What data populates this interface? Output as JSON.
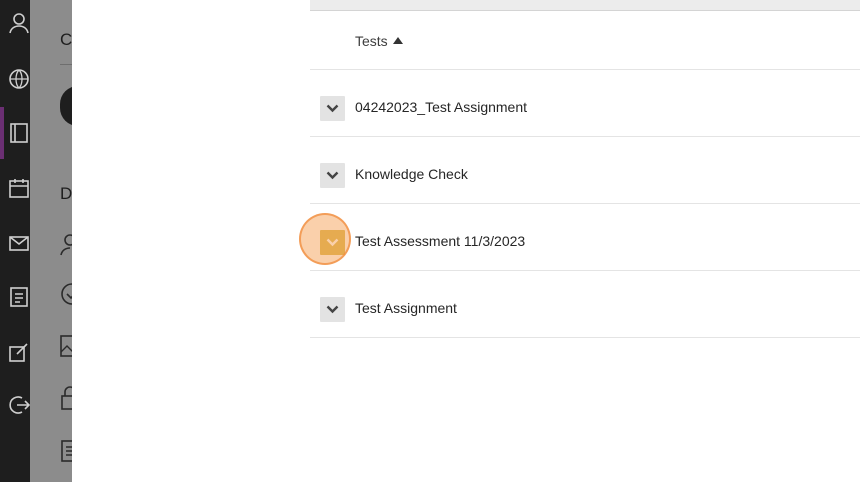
{
  "left_nav": {
    "icons": [
      "user-icon",
      "globe-icon",
      "courses-icon",
      "calendar-icon",
      "mail-icon",
      "grades-icon",
      "edit-icon",
      "signout-icon"
    ],
    "active_color": "#6b2f73"
  },
  "side_panel": {
    "heading_fragment": "C",
    "section_fragment": "D",
    "icons": [
      "person-icon",
      "check-circle-icon",
      "image-icon",
      "lock-icon",
      "clipboard-icon"
    ]
  },
  "table": {
    "header": {
      "label": "Tests",
      "sort": "ascending"
    },
    "rows": [
      {
        "label": "04242023_Test Assignment"
      },
      {
        "label": "Knowledge Check"
      },
      {
        "label": "Test Assessment 11/3/2023",
        "highlighted": true
      },
      {
        "label": "Test Assignment"
      }
    ]
  },
  "colors": {
    "highlight": "#d2ae36",
    "click_indicator": "#f6aa66"
  }
}
